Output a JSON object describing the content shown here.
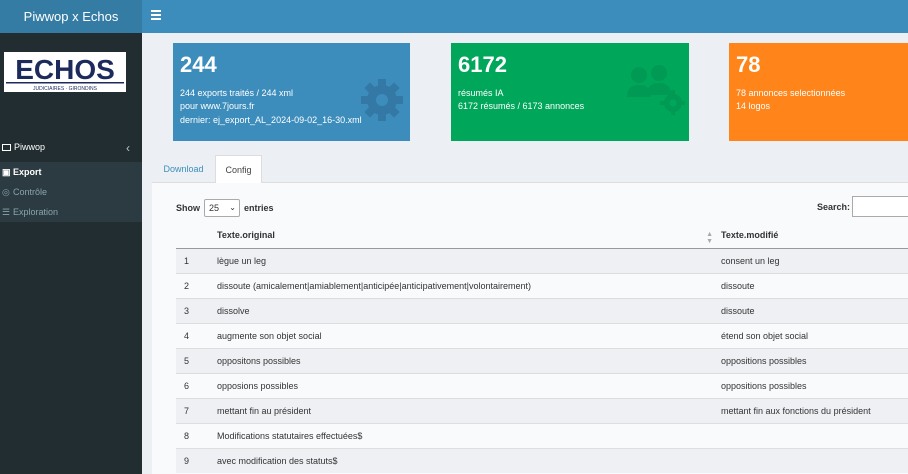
{
  "header": {
    "brand": "Piwwop x Echos"
  },
  "sidebar": {
    "logo_text": "ECHOS",
    "logo_subtext": "JUDICIAIRES · GIRONDINS",
    "menu_title": "Piwwop",
    "items": [
      {
        "label": "Export",
        "icon": "save-icon"
      },
      {
        "label": "Contrôle",
        "icon": "circle-icon"
      },
      {
        "label": "Exploration",
        "icon": "list-icon"
      }
    ]
  },
  "boxes": [
    {
      "value": "244",
      "lines": [
        "244 exports traités / 244 xml",
        "pour www.7jours.fr",
        "dernier: ej_export_AL_2024-09-02_16-30.xml"
      ],
      "color": "#3c8dbc",
      "icon": "gear-icon"
    },
    {
      "value": "6172",
      "lines": [
        "résumés IA",
        "6172 résumés / 6173 annonces"
      ],
      "color": "#00a65a",
      "icon": "users-gear-icon"
    },
    {
      "value": "78",
      "lines": [
        "78 annonces selectionnées",
        "14 logos"
      ],
      "color": "#ff851b"
    }
  ],
  "tabs": [
    {
      "label": "Download"
    },
    {
      "label": "Config"
    }
  ],
  "table": {
    "show_label": "Show",
    "entries_label": "entries",
    "page_size": "25",
    "search_label": "Search:",
    "columns": [
      "",
      "Texte.original",
      "Texte.modifié"
    ],
    "rows": [
      [
        "1",
        "lègue un leg",
        "consent un leg"
      ],
      [
        "2",
        "dissoute (amicalement|amiablement|anticipée|anticipativement|volontairement)",
        "dissoute"
      ],
      [
        "3",
        "dissolve",
        "dissoute"
      ],
      [
        "4",
        "augmente son objet social",
        "étend son objet social"
      ],
      [
        "5",
        "oppositons possibles",
        "oppositions possibles"
      ],
      [
        "6",
        "opposions possibles",
        "oppositions possibles"
      ],
      [
        "7",
        "mettant fin au président",
        "mettant fin aux fonctions du président"
      ],
      [
        "8",
        "Modifications statutaires effectuées$",
        ""
      ],
      [
        "9",
        "avec modification des statuts$",
        ""
      ]
    ]
  }
}
